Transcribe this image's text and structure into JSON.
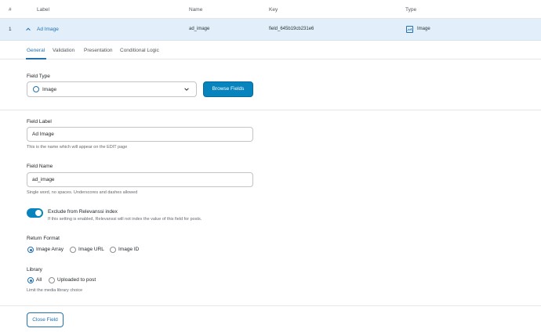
{
  "table_header": {
    "hash": "#",
    "label": "Label",
    "name": "Name",
    "key": "Key",
    "type": "Type"
  },
  "field_row": {
    "number": "1",
    "label": "Ad Image",
    "name": "ad_image",
    "key": "field_645b19cb231e6",
    "type": "Image"
  },
  "tabs": [
    "General",
    "Validation",
    "Presentation",
    "Conditional Logic"
  ],
  "field_type": {
    "label": "Field Type",
    "value": "Image",
    "browse_button": "Browse Fields"
  },
  "field_label": {
    "label": "Field Label",
    "value": "Ad Image",
    "hint": "This is the name which will appear on the EDIT page"
  },
  "field_name": {
    "label": "Field Name",
    "value": "ad_image",
    "hint": "Single word, no spaces. Underscores and dashes allowed"
  },
  "relevanssi": {
    "label": "Exclude from Relevanssi index",
    "hint": "If this setting is enabled, Relevanssi will not index the value of this field for posts.",
    "enabled": true
  },
  "return_format": {
    "label": "Return Format",
    "options": [
      "Image Array",
      "Image URL",
      "Image ID"
    ],
    "selected": "Image Array"
  },
  "library": {
    "label": "Library",
    "options": [
      "All",
      "Uploaded to post"
    ],
    "selected": "All",
    "hint": "Limit the media library choice"
  },
  "close_button": "Close Field",
  "colors": {
    "accent": "#2271b1",
    "primary_button": "#0783be",
    "row_highlight": "#e2effa"
  }
}
